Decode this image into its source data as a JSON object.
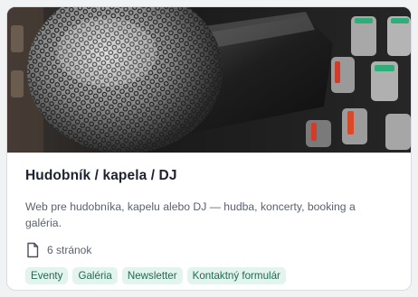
{
  "card": {
    "title": "Hudobník / kapela / DJ",
    "description": "Web pre hudobníka, kapelu alebo DJ — hudba, koncerty, booking a galéria.",
    "pages_count": "6 stránok",
    "tags": [
      "Eventy",
      "Galéria",
      "Newsletter",
      "Kontaktný formulár"
    ],
    "image_alt": "microphone-and-mixer-photo"
  },
  "colors": {
    "tag_bg": "#e3f3ee",
    "tag_text": "#1f6b52",
    "title": "#1e2230",
    "text": "#5a6170"
  }
}
